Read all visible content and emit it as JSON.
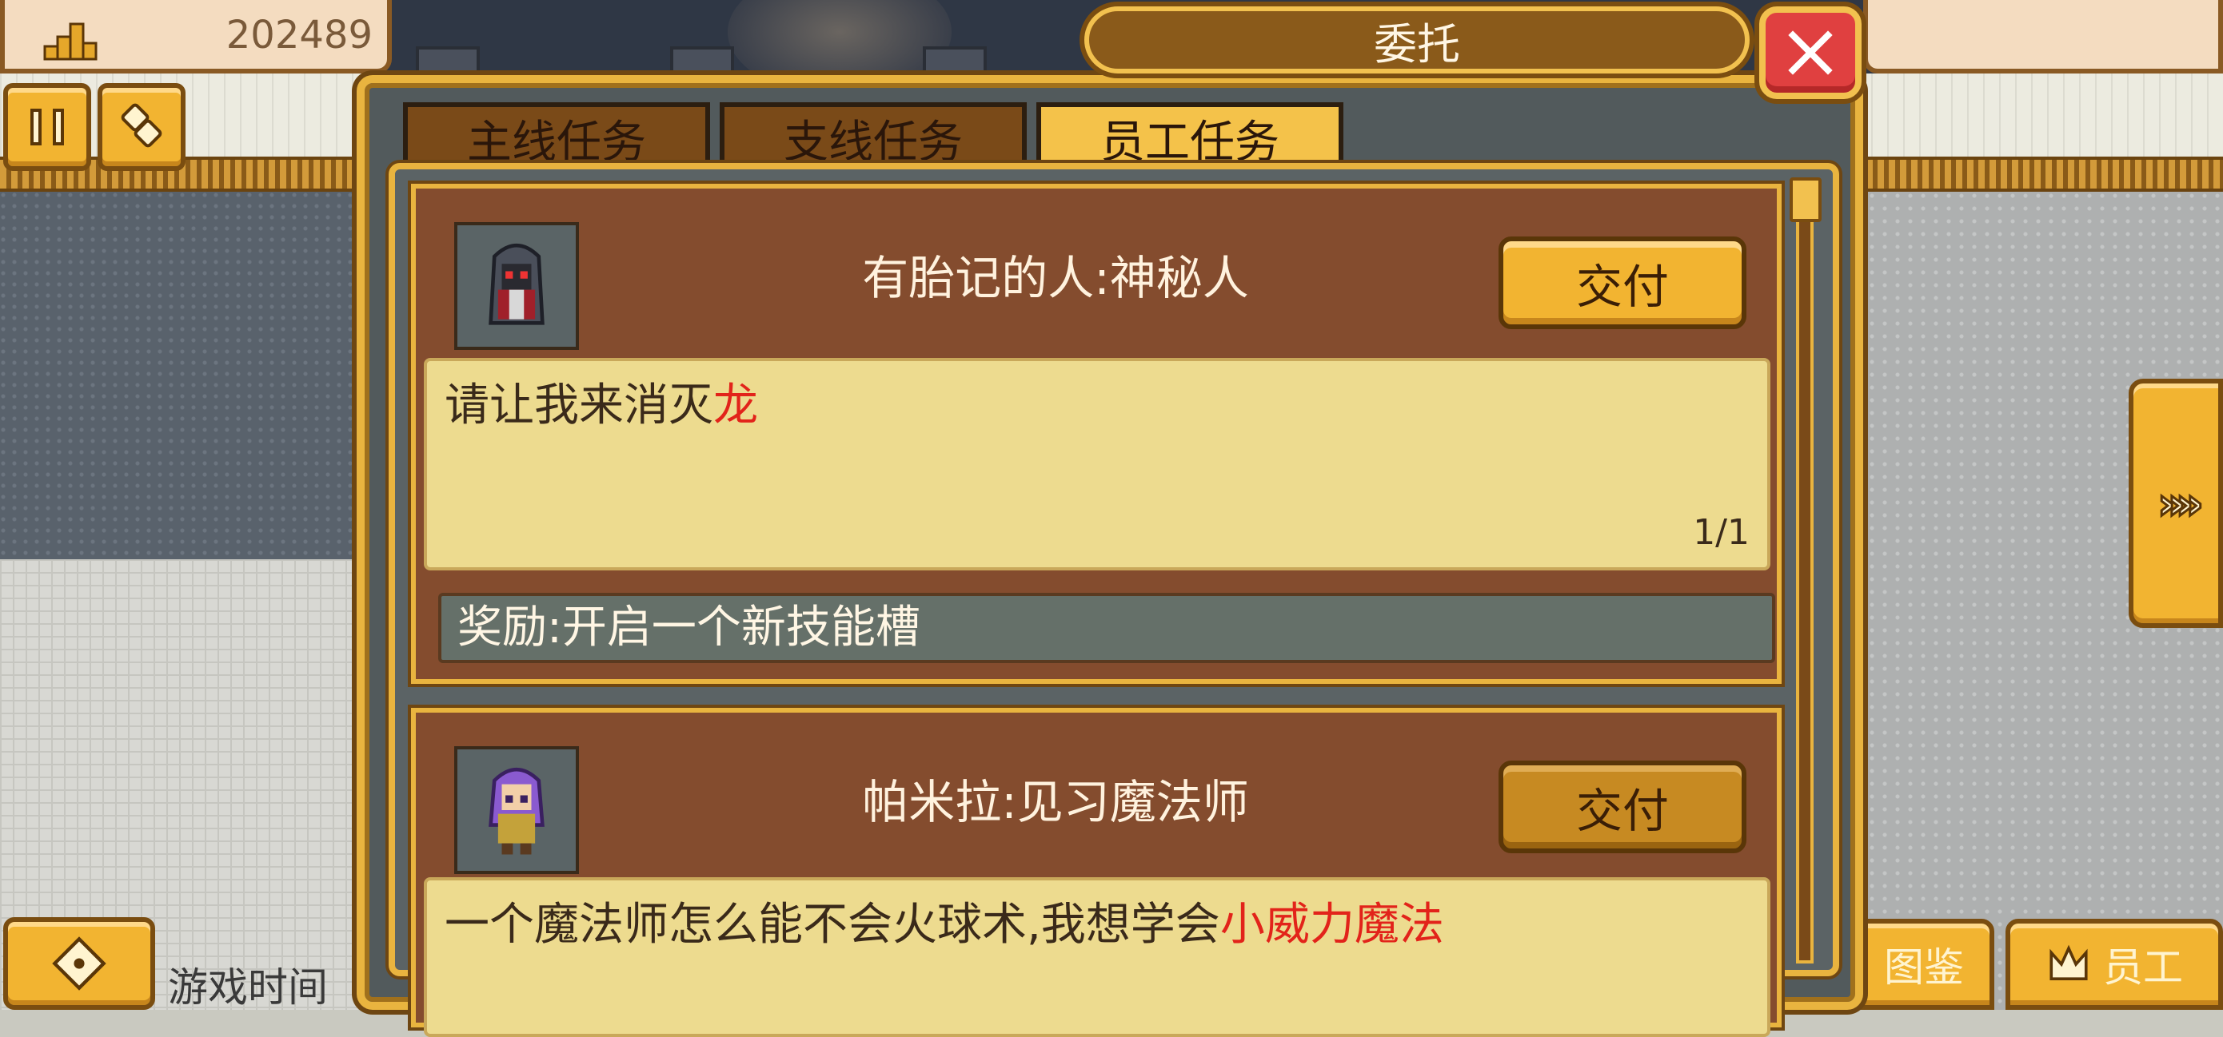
{
  "top_bar": {
    "money_value": "202489",
    "money_icon": "gold-stack-icon"
  },
  "dialog": {
    "title": "委托",
    "close_icon": "close-x-icon",
    "tabs": [
      {
        "label": "主线任务",
        "active": false
      },
      {
        "label": "支线任务",
        "active": false
      },
      {
        "label": "员工任务",
        "active": true
      }
    ],
    "quests": [
      {
        "portrait_icon": "hooded-mysterious-figure-sprite",
        "name": "有胎记的人:神秘人",
        "submit_label": "交付",
        "description_prefix": "请让我来消灭",
        "description_highlight": "龙",
        "progress": "1/1",
        "reward": "奖励:开启一个新技能槽"
      },
      {
        "portrait_icon": "purple-haired-mage-sprite",
        "name": "帕米拉:见习魔法师",
        "submit_label": "交付",
        "description_prefix": "一个魔法师怎么能不会火球术,我想学会",
        "description_highlight": "小威力魔法"
      }
    ]
  },
  "hud": {
    "pause_icon": "pause-icon",
    "misc_icon": "items-icon",
    "side_arrow_icon": "double-chevron-right-icon",
    "move_icon": "dpad-icon",
    "game_time_label": "游戏时间",
    "codex_label": "图鉴",
    "staff_label": "员工",
    "staff_icon": "crown-icon"
  },
  "colors": {
    "gold": "#f2b431",
    "card_brown": "#844c2e",
    "parchment": "#eddb8f",
    "highlight_red": "#e2231a",
    "close_red": "#e04040"
  }
}
